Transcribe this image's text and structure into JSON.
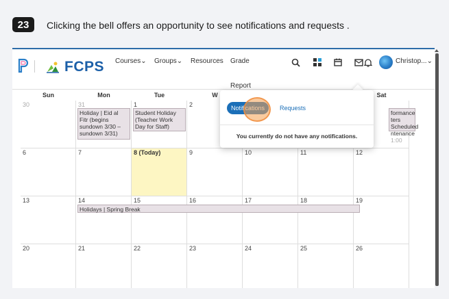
{
  "step": {
    "number": "23",
    "text": "Clicking the bell offers an opportunity to see notifications and requests ."
  },
  "logo": {
    "text": "FCPS"
  },
  "nav": {
    "courses": "Courses⌄",
    "groups": "Groups⌄",
    "resources": "Resources",
    "grade": "Grade",
    "report": "Report"
  },
  "user": {
    "name": "Christop...⌄"
  },
  "calendar": {
    "weekdays": [
      "Sun",
      "Mon",
      "Tue",
      "W",
      "",
      "",
      "Sat"
    ],
    "rows": [
      [
        "30",
        "31",
        "1",
        "2",
        "",
        "",
        ""
      ],
      [
        "6",
        "7",
        "8 (Today)",
        "9",
        "10",
        "11",
        "12"
      ],
      [
        "13",
        "14",
        "15",
        "16",
        "17",
        "18",
        "19"
      ],
      [
        "20",
        "21",
        "22",
        "23",
        "24",
        "25",
        "26"
      ]
    ],
    "events": {
      "eid": "Holiday | Eid al Fitr (begins sundown 3/30 – sundown 3/31)",
      "student_holiday": "Student Holiday (Teacher Work Day for Staff)",
      "maint_1": "formance",
      "maint_2": "ters Scheduled",
      "maint_3": "ntenance",
      "maint_time": "1:00",
      "spring_break": "Holidays | Spring Break"
    }
  },
  "popup": {
    "tab_notifications": "Notifications",
    "tab_requests": "Requests",
    "empty_message": "You currently do not have any notifications."
  },
  "colors": {
    "accent": "#1b6fb8",
    "today": "#fdf6c3",
    "event_bg": "#e8e1e6"
  }
}
